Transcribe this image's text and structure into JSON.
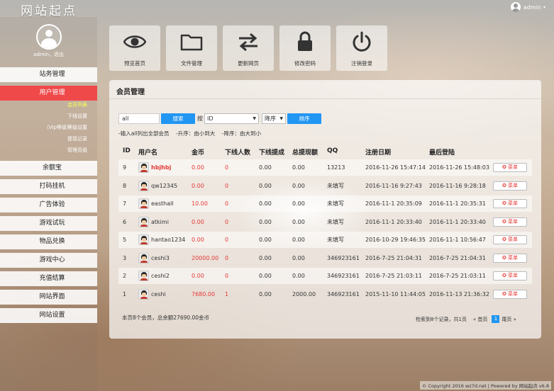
{
  "brand": "网站起点",
  "user": {
    "name": "admin",
    "caret": "▾"
  },
  "profile": {
    "name": "admin",
    "sep": "，",
    "logout": "退出"
  },
  "sidebar": {
    "items": [
      {
        "label": "站务管理"
      },
      {
        "label": "用户管理",
        "active": true
      },
      {
        "label": "余额宝"
      },
      {
        "label": "打码挂机"
      },
      {
        "label": "广告体验"
      },
      {
        "label": "游戏试玩"
      },
      {
        "label": "物品兑换"
      },
      {
        "label": "游戏中心"
      },
      {
        "label": "充值结算"
      },
      {
        "label": "网站界面"
      },
      {
        "label": "网站设置"
      }
    ],
    "subitems": [
      {
        "label": "会员列表",
        "current": true
      },
      {
        "label": "下线设置"
      },
      {
        "prefix": "（Vip等级）",
        "label": "等级设置"
      },
      {
        "label": "提现记录"
      },
      {
        "label": "管理员组"
      }
    ]
  },
  "shortcuts": [
    {
      "label": "预览首页",
      "icon": "eye-icon"
    },
    {
      "label": "文件管理",
      "icon": "folder-icon"
    },
    {
      "label": "更新网页",
      "icon": "exchange-icon"
    },
    {
      "label": "修改密码",
      "icon": "lock-icon"
    },
    {
      "label": "注销登录",
      "icon": "power-icon"
    }
  ],
  "panel": {
    "title": "会员管理",
    "search_value": "all",
    "search_btn": "搜索",
    "by": "按",
    "field_select": "ID",
    "order_select": "降序",
    "sort_btn": "排序",
    "hint": "-输入all列出全部会员    -升序：由小到大    -降序：由大到小"
  },
  "table": {
    "headers": [
      "ID",
      "用户名",
      "金币",
      "下线人数",
      "下线提成",
      "总提现额",
      "QQ",
      "注册日期",
      "最后登陆"
    ],
    "menu_label": "✪ 菜单",
    "rows": [
      {
        "id": "9",
        "name": "hbjhbj",
        "gold": "0.00",
        "downline": "0",
        "commission": "0.00",
        "withdraw": "0.00",
        "qq": "13213",
        "reg": "2016-11-26 15:47:14",
        "last": "2016-11-26 15:48:03",
        "name_red": true
      },
      {
        "id": "8",
        "name": "qw12345",
        "gold": "0.00",
        "downline": "0",
        "commission": "0.00",
        "withdraw": "0.00",
        "qq": "未填写",
        "reg": "2016-11-16 9:27:43",
        "last": "2016-11-16 9:28:18"
      },
      {
        "id": "7",
        "name": "easthall",
        "gold": "10.00",
        "downline": "0",
        "commission": "0.00",
        "withdraw": "0.00",
        "qq": "未填写",
        "reg": "2016-11-1 20:35:09",
        "last": "2016-11-1 20:35:31"
      },
      {
        "id": "6",
        "name": "atkimi",
        "gold": "0.00",
        "downline": "0",
        "commission": "0.00",
        "withdraw": "0.00",
        "qq": "未填写",
        "reg": "2016-11-1 20:33:40",
        "last": "2016-11-1 20:33:40"
      },
      {
        "id": "5",
        "name": "hantao1234",
        "gold": "0.00",
        "downline": "0",
        "commission": "0.00",
        "withdraw": "0.00",
        "qq": "未填写",
        "reg": "2016-10-29 19:46:35",
        "last": "2016-11-1 10:56:47"
      },
      {
        "id": "3",
        "name": "ceshi3",
        "gold": "20000.00",
        "downline": "0",
        "commission": "0.00",
        "withdraw": "0.00",
        "qq": "346923161",
        "reg": "2016-7-25 21:04:31",
        "last": "2016-7-25 21:04:31"
      },
      {
        "id": "2",
        "name": "ceshi2",
        "gold": "0.00",
        "downline": "0",
        "commission": "0.00",
        "withdraw": "0.00",
        "qq": "346923161",
        "reg": "2016-7-25 21:03:11",
        "last": "2016-7-25 21:03:11"
      },
      {
        "id": "1",
        "name": "ceshi",
        "gold": "7680.00",
        "downline": "1",
        "commission": "0.00",
        "withdraw": "2000.00",
        "qq": "346923161",
        "reg": "2015-11-10 11:44:05",
        "last": "2016-11-13 21:36:32"
      }
    ]
  },
  "footer": {
    "summary": "本页8个会员，总余额27690.00金币",
    "records": "检索到8个记录，共1页",
    "first": "« 首页",
    "current": "1",
    "last": "尾页 »"
  },
  "copyright": "© Copyright 2016 wz7d.net | Powered by 网站起点 v6.8"
}
